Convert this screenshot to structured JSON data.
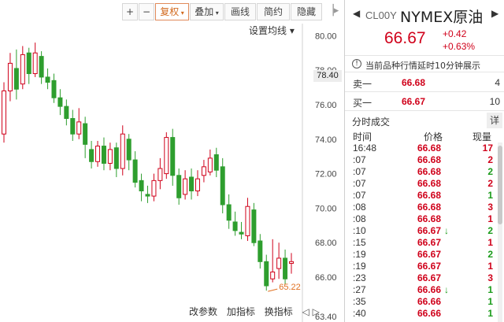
{
  "toolbar": {
    "plus": "+",
    "minus": "−",
    "fuquan": "复权",
    "diejia": "叠加",
    "huaxian": "画线",
    "jianyue": "简约",
    "yincang": "隐藏",
    "prev": "❘◁",
    "next": "▷❘"
  },
  "ma_setting": "设置均线 ▾",
  "price_tag": "78.40",
  "bottom_links": [
    "改参数",
    "加指标",
    "换指标"
  ],
  "bottom_nav": "◁ ▷",
  "chart_data": {
    "type": "candlestick",
    "y_ticks": [
      "80.00",
      "78.00",
      "76.00",
      "74.00",
      "72.00",
      "70.00",
      "68.00",
      "66.00",
      "63.40"
    ],
    "ylim": [
      63.4,
      80.7
    ],
    "min_label": "65.22",
    "candles": [
      {
        "o": 74.3,
        "c": 76.8,
        "h": 77.3,
        "l": 73.8
      },
      {
        "o": 76.8,
        "c": 78.4,
        "h": 79.0,
        "l": 76.2
      },
      {
        "o": 78.1,
        "c": 76.9,
        "h": 79.2,
        "l": 76.3
      },
      {
        "o": 77.2,
        "c": 78.9,
        "h": 79.4,
        "l": 76.9
      },
      {
        "o": 79.0,
        "c": 77.8,
        "h": 79.3,
        "l": 77.2
      },
      {
        "o": 77.8,
        "c": 79.0,
        "h": 79.6,
        "l": 77.6
      },
      {
        "o": 78.8,
        "c": 77.6,
        "h": 79.1,
        "l": 77.2
      },
      {
        "o": 77.6,
        "c": 77.3,
        "h": 78.1,
        "l": 76.9
      },
      {
        "o": 77.4,
        "c": 76.4,
        "h": 77.8,
        "l": 76.1
      },
      {
        "o": 76.4,
        "c": 75.9,
        "h": 76.9,
        "l": 75.4
      },
      {
        "o": 75.9,
        "c": 75.2,
        "h": 76.3,
        "l": 74.8
      },
      {
        "o": 75.2,
        "c": 74.3,
        "h": 75.7,
        "l": 73.9
      },
      {
        "o": 74.3,
        "c": 75.0,
        "h": 75.8,
        "l": 74.0
      },
      {
        "o": 74.9,
        "c": 73.7,
        "h": 75.3,
        "l": 72.9
      },
      {
        "o": 73.4,
        "c": 72.7,
        "h": 73.9,
        "l": 72.3
      },
      {
        "o": 72.7,
        "c": 73.6,
        "h": 73.9,
        "l": 72.4
      },
      {
        "o": 73.6,
        "c": 72.6,
        "h": 74.1,
        "l": 72.2
      },
      {
        "o": 72.6,
        "c": 73.4,
        "h": 73.8,
        "l": 72.2
      },
      {
        "o": 73.5,
        "c": 72.3,
        "h": 73.8,
        "l": 71.8
      },
      {
        "o": 72.3,
        "c": 74.3,
        "h": 74.8,
        "l": 71.9
      },
      {
        "o": 74.0,
        "c": 72.8,
        "h": 74.3,
        "l": 72.2
      },
      {
        "o": 72.8,
        "c": 71.5,
        "h": 73.3,
        "l": 71.2
      },
      {
        "o": 71.6,
        "c": 71.0,
        "h": 72.0,
        "l": 70.4
      },
      {
        "o": 70.8,
        "c": 70.7,
        "h": 71.3,
        "l": 70.3
      },
      {
        "o": 70.7,
        "c": 71.6,
        "h": 72.0,
        "l": 70.4
      },
      {
        "o": 71.6,
        "c": 72.3,
        "h": 72.9,
        "l": 71.1
      },
      {
        "o": 72.0,
        "c": 74.1,
        "h": 74.4,
        "l": 71.7
      },
      {
        "o": 74.1,
        "c": 71.9,
        "h": 74.6,
        "l": 71.3
      },
      {
        "o": 71.9,
        "c": 70.6,
        "h": 72.3,
        "l": 70.2
      },
      {
        "o": 70.8,
        "c": 71.7,
        "h": 72.2,
        "l": 70.5
      },
      {
        "o": 71.8,
        "c": 71.0,
        "h": 72.3,
        "l": 70.5
      },
      {
        "o": 71.0,
        "c": 71.7,
        "h": 72.2,
        "l": 70.7
      },
      {
        "o": 71.9,
        "c": 72.4,
        "h": 72.8,
        "l": 71.5
      },
      {
        "o": 72.1,
        "c": 72.9,
        "h": 73.4,
        "l": 71.9
      },
      {
        "o": 73.1,
        "c": 72.2,
        "h": 73.5,
        "l": 71.8
      },
      {
        "o": 72.4,
        "c": 70.2,
        "h": 72.9,
        "l": 69.7
      },
      {
        "o": 70.2,
        "c": 69.3,
        "h": 70.8,
        "l": 68.8
      },
      {
        "o": 69.2,
        "c": 68.7,
        "h": 69.8,
        "l": 68.4
      },
      {
        "o": 68.6,
        "c": 68.5,
        "h": 69.2,
        "l": 68.2
      },
      {
        "o": 68.4,
        "c": 70.1,
        "h": 70.6,
        "l": 68.1
      },
      {
        "o": 69.9,
        "c": 68.0,
        "h": 70.3,
        "l": 67.8
      },
      {
        "o": 68.1,
        "c": 66.9,
        "h": 68.5,
        "l": 66.5
      },
      {
        "o": 66.9,
        "c": 65.5,
        "h": 67.3,
        "l": 65.22
      },
      {
        "o": 65.9,
        "c": 66.3,
        "h": 68.2,
        "l": 65.7
      },
      {
        "o": 66.5,
        "c": 67.1,
        "h": 68.0,
        "l": 65.9
      },
      {
        "o": 67.1,
        "c": 65.9,
        "h": 67.6,
        "l": 65.6
      },
      {
        "o": 66.8,
        "c": 66.9,
        "h": 67.4,
        "l": 66.2
      }
    ]
  },
  "quote": {
    "nav_left": "◀",
    "nav_right": "▶",
    "code": "CL00Y",
    "name": "NYMEX原油",
    "price": "66.67",
    "change": "+0.42",
    "pct": "+0.63%",
    "notice_icon": "!",
    "notice": "当前品种行情延时10分钟展示",
    "sell_label": "卖一",
    "sell_price": "66.68",
    "sell_vol": "4",
    "buy_label": "买一",
    "buy_price": "66.67",
    "buy_vol": "10",
    "ticks_title": "分时成交",
    "detail_btn": "详",
    "col_time": "时间",
    "col_price": "价格",
    "col_vol": "现量",
    "ticks": [
      {
        "t": "16:48",
        "p": "66.68",
        "d": "",
        "v": "17",
        "c": "red"
      },
      {
        "t": ":07",
        "p": "66.68",
        "d": "",
        "v": "2",
        "c": "red"
      },
      {
        "t": ":07",
        "p": "66.68",
        "d": "",
        "v": "2",
        "c": "green"
      },
      {
        "t": ":07",
        "p": "66.68",
        "d": "",
        "v": "2",
        "c": "red"
      },
      {
        "t": ":07",
        "p": "66.68",
        "d": "",
        "v": "1",
        "c": "green"
      },
      {
        "t": ":08",
        "p": "66.68",
        "d": "",
        "v": "3",
        "c": "red"
      },
      {
        "t": ":08",
        "p": "66.68",
        "d": "",
        "v": "1",
        "c": "red"
      },
      {
        "t": ":10",
        "p": "66.67",
        "d": "↓",
        "v": "2",
        "c": "green"
      },
      {
        "t": ":15",
        "p": "66.67",
        "d": "",
        "v": "1",
        "c": "red"
      },
      {
        "t": ":19",
        "p": "66.67",
        "d": "",
        "v": "2",
        "c": "green"
      },
      {
        "t": ":19",
        "p": "66.67",
        "d": "",
        "v": "1",
        "c": "red"
      },
      {
        "t": ":23",
        "p": "66.67",
        "d": "",
        "v": "3",
        "c": "red"
      },
      {
        "t": ":27",
        "p": "66.66",
        "d": "↓",
        "v": "1",
        "c": "green"
      },
      {
        "t": ":35",
        "p": "66.66",
        "d": "",
        "v": "1",
        "c": "green"
      },
      {
        "t": ":40",
        "p": "66.66",
        "d": "",
        "v": "1",
        "c": "green"
      }
    ]
  }
}
